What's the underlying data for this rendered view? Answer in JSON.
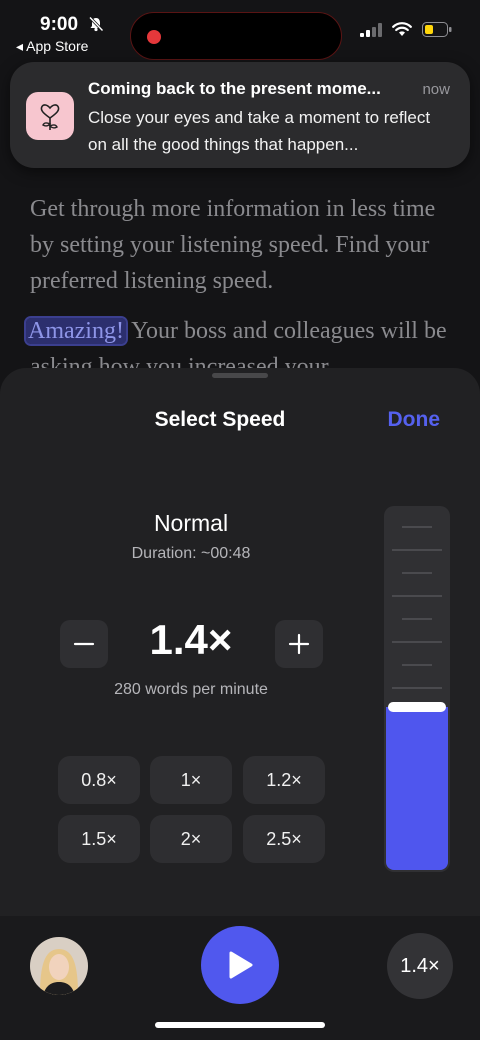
{
  "status_bar": {
    "time": "9:00",
    "back_label": "◂ App Store"
  },
  "article": {
    "p1": "Get through more information in less time by setting your listening speed. Find your preferred listening speed.",
    "highlight": "Amazing!",
    "p2_rest": " Your boss and colleagues will be asking how you increased your"
  },
  "notification": {
    "title": "Coming back to the present mome...",
    "time": "now",
    "body": "Close your eyes and take a moment to reflect on all the good things that happen..."
  },
  "sheet": {
    "title": "Select Speed",
    "done_label": "Done",
    "preset_name": "Normal",
    "duration": "Duration: ~00:48",
    "speed": "1.4×",
    "wpm": "280 words per minute",
    "presets": [
      "0.8×",
      "1×",
      "1.2×",
      "1.5×",
      "2×",
      "2.5×"
    ],
    "slider_level": 0.45
  },
  "player": {
    "speed_label": "1.4×"
  },
  "colors": {
    "accent": "#5058ee",
    "notif_icon_bg": "#f7c6cf",
    "record": "#e5383b"
  }
}
